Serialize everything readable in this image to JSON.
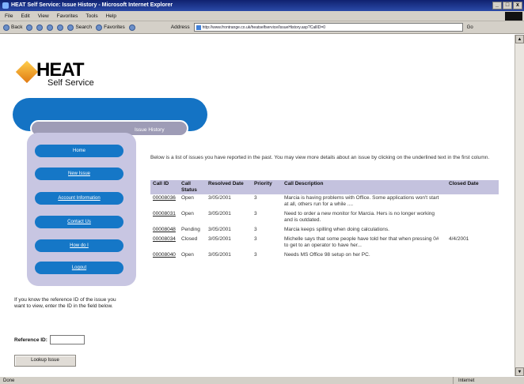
{
  "window": {
    "title": "HEAT Self Service: Issue History - Microsoft Internet Explorer",
    "buttons": [
      "_",
      "□",
      "x"
    ]
  },
  "menubar": [
    "File",
    "Edit",
    "View",
    "Favorites",
    "Tools",
    "Help"
  ],
  "toolbar": {
    "back": "Back",
    "search": "Search",
    "favorites": "Favorites",
    "address_label": "Address",
    "address_url": "http://www.frontrange.co.uk/heatselfservice/IssueHistory.asp?CallID=0",
    "go": "Go"
  },
  "logo": {
    "name": "HEAT",
    "tagline": "Self Service"
  },
  "section_tab": "Issue History",
  "nav": [
    {
      "label": "Home",
      "underlined": false
    },
    {
      "label": "New Issue",
      "underlined": true
    },
    {
      "label": "Account Information",
      "underlined": true
    },
    {
      "label": "Contact Us",
      "underlined": true
    },
    {
      "label": "How do I",
      "underlined": true
    },
    {
      "label": "Logout",
      "underlined": true
    }
  ],
  "lookup": {
    "help_text": "If you know the reference ID of the issue you want to view, enter the ID in the field below.",
    "label": "Reference ID:",
    "input_value": "",
    "button": "Lookup Issue"
  },
  "intro": "Below is a list of issues you have reported in the past. You may view more details about an issue by clicking on the underlined text in the first column.",
  "table": {
    "headers": [
      "Call ID",
      "Call Status",
      "Resolved Date",
      "Priority",
      "Call Description",
      "Closed Date"
    ],
    "rows": [
      {
        "id": "00008036",
        "status": "Open",
        "resolved": "3/05/2001",
        "priority": "3",
        "desc": "Marcia is having problems with Office. Some applications won't start at all, others run for a while ....",
        "closed": ""
      },
      {
        "id": "00008031",
        "status": "Open",
        "resolved": "3/05/2001",
        "priority": "3",
        "desc": "Need to order a new monitor for Marcia. Hers is no longer working and is outdated.",
        "closed": ""
      },
      {
        "id": "00008048",
        "status": "Pending",
        "resolved": "3/05/2001",
        "priority": "3",
        "desc": "Marcia keeps spilling when doing calculations.",
        "closed": ""
      },
      {
        "id": "00008034",
        "status": "Closed",
        "resolved": "3/05/2001",
        "priority": "3",
        "desc": "Michelle says that some people have told her that when pressing 0# to get to an operator to have her...",
        "closed": "4/4/2001"
      },
      {
        "id": "00008040",
        "status": "Open",
        "resolved": "3/05/2001",
        "priority": "3",
        "desc": "Needs MS Office 98 setup on her PC.",
        "closed": ""
      }
    ]
  },
  "statusbar": {
    "left": "Done",
    "zone": "Internet"
  },
  "colors": {
    "nav_button": "#1577c7",
    "nav_panel": "#c8c6e2",
    "table_header": "#c4c2de",
    "title_bar": "#10226f"
  }
}
